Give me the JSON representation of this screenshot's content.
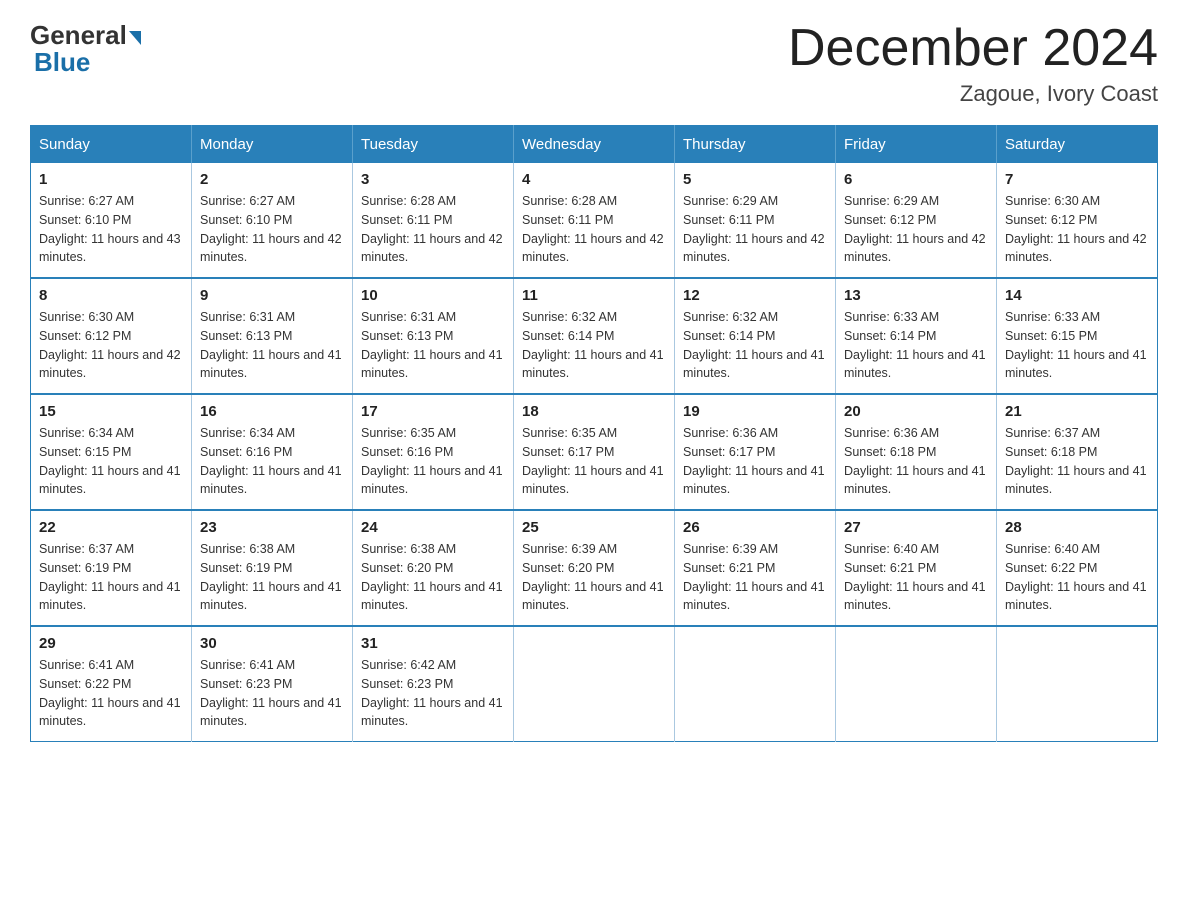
{
  "logo": {
    "general": "General",
    "blue": "Blue"
  },
  "title": "December 2024",
  "subtitle": "Zagoue, Ivory Coast",
  "days_of_week": [
    "Sunday",
    "Monday",
    "Tuesday",
    "Wednesday",
    "Thursday",
    "Friday",
    "Saturday"
  ],
  "weeks": [
    [
      {
        "day": "1",
        "sunrise": "6:27 AM",
        "sunset": "6:10 PM",
        "daylight": "11 hours and 43 minutes."
      },
      {
        "day": "2",
        "sunrise": "6:27 AM",
        "sunset": "6:10 PM",
        "daylight": "11 hours and 42 minutes."
      },
      {
        "day": "3",
        "sunrise": "6:28 AM",
        "sunset": "6:11 PM",
        "daylight": "11 hours and 42 minutes."
      },
      {
        "day": "4",
        "sunrise": "6:28 AM",
        "sunset": "6:11 PM",
        "daylight": "11 hours and 42 minutes."
      },
      {
        "day": "5",
        "sunrise": "6:29 AM",
        "sunset": "6:11 PM",
        "daylight": "11 hours and 42 minutes."
      },
      {
        "day": "6",
        "sunrise": "6:29 AM",
        "sunset": "6:12 PM",
        "daylight": "11 hours and 42 minutes."
      },
      {
        "day": "7",
        "sunrise": "6:30 AM",
        "sunset": "6:12 PM",
        "daylight": "11 hours and 42 minutes."
      }
    ],
    [
      {
        "day": "8",
        "sunrise": "6:30 AM",
        "sunset": "6:12 PM",
        "daylight": "11 hours and 42 minutes."
      },
      {
        "day": "9",
        "sunrise": "6:31 AM",
        "sunset": "6:13 PM",
        "daylight": "11 hours and 41 minutes."
      },
      {
        "day": "10",
        "sunrise": "6:31 AM",
        "sunset": "6:13 PM",
        "daylight": "11 hours and 41 minutes."
      },
      {
        "day": "11",
        "sunrise": "6:32 AM",
        "sunset": "6:14 PM",
        "daylight": "11 hours and 41 minutes."
      },
      {
        "day": "12",
        "sunrise": "6:32 AM",
        "sunset": "6:14 PM",
        "daylight": "11 hours and 41 minutes."
      },
      {
        "day": "13",
        "sunrise": "6:33 AM",
        "sunset": "6:14 PM",
        "daylight": "11 hours and 41 minutes."
      },
      {
        "day": "14",
        "sunrise": "6:33 AM",
        "sunset": "6:15 PM",
        "daylight": "11 hours and 41 minutes."
      }
    ],
    [
      {
        "day": "15",
        "sunrise": "6:34 AM",
        "sunset": "6:15 PM",
        "daylight": "11 hours and 41 minutes."
      },
      {
        "day": "16",
        "sunrise": "6:34 AM",
        "sunset": "6:16 PM",
        "daylight": "11 hours and 41 minutes."
      },
      {
        "day": "17",
        "sunrise": "6:35 AM",
        "sunset": "6:16 PM",
        "daylight": "11 hours and 41 minutes."
      },
      {
        "day": "18",
        "sunrise": "6:35 AM",
        "sunset": "6:17 PM",
        "daylight": "11 hours and 41 minutes."
      },
      {
        "day": "19",
        "sunrise": "6:36 AM",
        "sunset": "6:17 PM",
        "daylight": "11 hours and 41 minutes."
      },
      {
        "day": "20",
        "sunrise": "6:36 AM",
        "sunset": "6:18 PM",
        "daylight": "11 hours and 41 minutes."
      },
      {
        "day": "21",
        "sunrise": "6:37 AM",
        "sunset": "6:18 PM",
        "daylight": "11 hours and 41 minutes."
      }
    ],
    [
      {
        "day": "22",
        "sunrise": "6:37 AM",
        "sunset": "6:19 PM",
        "daylight": "11 hours and 41 minutes."
      },
      {
        "day": "23",
        "sunrise": "6:38 AM",
        "sunset": "6:19 PM",
        "daylight": "11 hours and 41 minutes."
      },
      {
        "day": "24",
        "sunrise": "6:38 AM",
        "sunset": "6:20 PM",
        "daylight": "11 hours and 41 minutes."
      },
      {
        "day": "25",
        "sunrise": "6:39 AM",
        "sunset": "6:20 PM",
        "daylight": "11 hours and 41 minutes."
      },
      {
        "day": "26",
        "sunrise": "6:39 AM",
        "sunset": "6:21 PM",
        "daylight": "11 hours and 41 minutes."
      },
      {
        "day": "27",
        "sunrise": "6:40 AM",
        "sunset": "6:21 PM",
        "daylight": "11 hours and 41 minutes."
      },
      {
        "day": "28",
        "sunrise": "6:40 AM",
        "sunset": "6:22 PM",
        "daylight": "11 hours and 41 minutes."
      }
    ],
    [
      {
        "day": "29",
        "sunrise": "6:41 AM",
        "sunset": "6:22 PM",
        "daylight": "11 hours and 41 minutes."
      },
      {
        "day": "30",
        "sunrise": "6:41 AM",
        "sunset": "6:23 PM",
        "daylight": "11 hours and 41 minutes."
      },
      {
        "day": "31",
        "sunrise": "6:42 AM",
        "sunset": "6:23 PM",
        "daylight": "11 hours and 41 minutes."
      },
      null,
      null,
      null,
      null
    ]
  ],
  "labels": {
    "sunrise": "Sunrise:",
    "sunset": "Sunset:",
    "daylight": "Daylight:"
  }
}
